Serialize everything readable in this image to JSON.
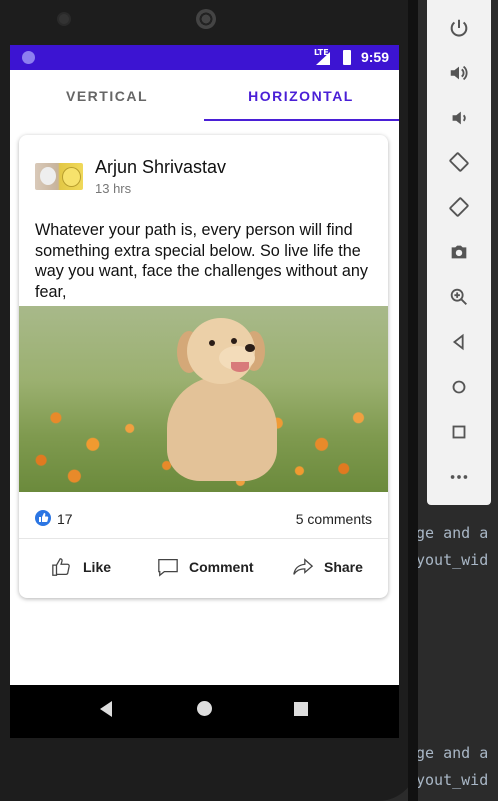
{
  "tabs": {
    "vertical": "VERTICAL",
    "horizontal": "HORIZONTAL",
    "selected": "HORIZONTAL"
  },
  "status": {
    "time": "9:59",
    "network": "LTE"
  },
  "post": {
    "author": "Arjun Shrivastav",
    "time": "13 hrs",
    "text": "Whatever your path is, every person will find something extra special below. So live life the way you want, face the challenges without any fear,",
    "likes": "17",
    "comments": "5 comments"
  },
  "actions": {
    "like": "Like",
    "comment": "Comment",
    "share": "Share"
  },
  "ide": {
    "line1": "ge and a",
    "line2": "yout_wid",
    "line3": "ge and a",
    "line4": "yout_wid"
  },
  "emulator": {
    "icons": [
      "power-icon",
      "volume-up-icon",
      "volume-down-icon",
      "rotate-left-icon",
      "rotate-right-icon",
      "camera-icon",
      "zoom-icon",
      "back-icon",
      "home-icon",
      "overview-icon",
      "more-icon"
    ]
  },
  "colors": {
    "accent": "#4a1fd6",
    "statusbar": "#3c14d2",
    "like": "#2c76e3"
  }
}
